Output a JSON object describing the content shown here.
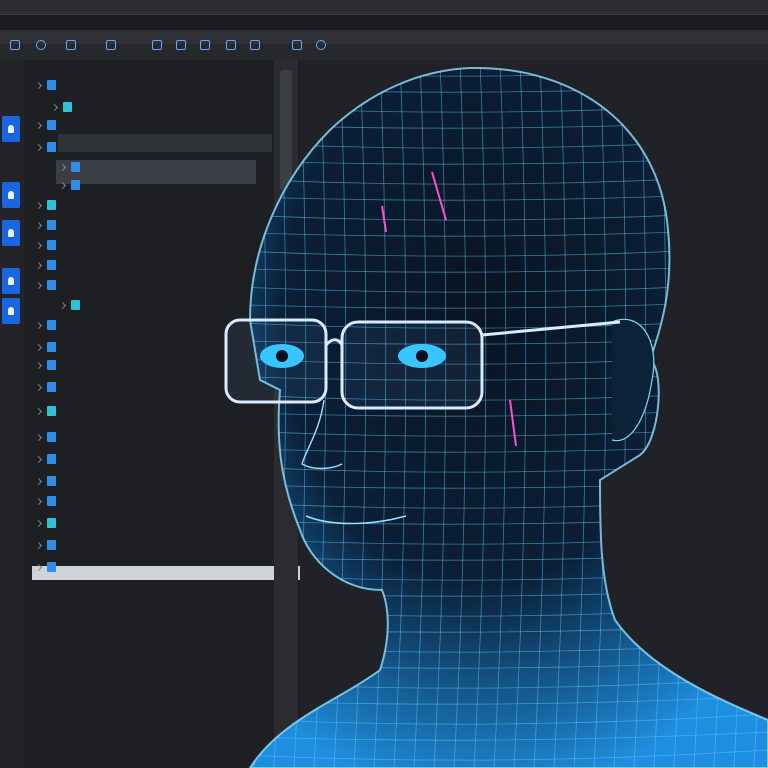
{
  "window": {
    "title": ""
  },
  "toolbar": {
    "icons": [
      "info-icon",
      "search-icon",
      "file-icon",
      "folder-icon",
      "save-icon",
      "grid-icon",
      "list-icon",
      "settings-icon",
      "layers-icon",
      "cloud-icon",
      "refresh-icon"
    ]
  },
  "sidebar": {
    "rows": [
      {
        "label": "",
        "icon": "file-icon"
      },
      {
        "label": "",
        "icon": "file-icon"
      },
      {
        "label": "",
        "icon": "folder-icon"
      },
      {
        "label": "",
        "icon": "file-icon"
      },
      {
        "label": "",
        "icon": "file-icon"
      },
      {
        "label": "",
        "icon": "file-icon"
      },
      {
        "label": "",
        "icon": "file-icon"
      },
      {
        "label": "",
        "icon": "file-icon"
      },
      {
        "label": "",
        "icon": "file-icon"
      },
      {
        "label": "",
        "icon": "file-icon"
      },
      {
        "label": "",
        "icon": "file-icon"
      },
      {
        "label": "",
        "icon": "file-icon"
      },
      {
        "label": "",
        "icon": "file-icon"
      },
      {
        "label": "",
        "icon": "file-icon"
      },
      {
        "label": "",
        "icon": "file-icon"
      },
      {
        "label": "",
        "icon": "file-icon"
      },
      {
        "label": "",
        "icon": "file-icon"
      },
      {
        "label": "",
        "icon": "file-icon"
      },
      {
        "label": "",
        "icon": "file-icon"
      },
      {
        "label": "",
        "icon": "file-icon"
      },
      {
        "label": "",
        "icon": "file-icon"
      },
      {
        "label": "",
        "icon": "file-icon"
      },
      {
        "label": "",
        "icon": "file-icon"
      },
      {
        "label": "",
        "icon": "file-icon"
      }
    ]
  },
  "canvas": {
    "subject": "wireframe-head-with-glasses",
    "colors": {
      "mesh": "#6fd3ff",
      "glow": "#1e9bff",
      "eyes": "#39c6ff",
      "accent": "#ff4fd0"
    }
  }
}
